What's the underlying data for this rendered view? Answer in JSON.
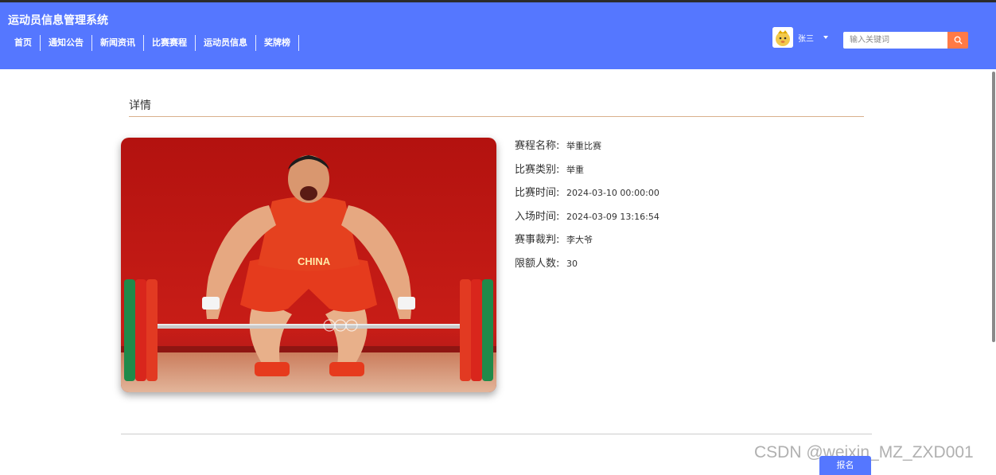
{
  "header": {
    "site_title": "运动员信息管理系统",
    "nav": [
      "首页",
      "通知公告",
      "新闻资讯",
      "比赛赛程",
      "运动员信息",
      "奖牌榜"
    ],
    "user_name": "张三",
    "search_placeholder": "输入关键词"
  },
  "detail": {
    "section_title": "详情",
    "image_text": "CHINA",
    "fields": [
      {
        "label": "赛程名称:",
        "value": "举重比赛"
      },
      {
        "label": "比赛类别:",
        "value": "举重"
      },
      {
        "label": "比赛时间:",
        "value": "2024-03-10 00:00:00"
      },
      {
        "label": "入场时间:",
        "value": "2024-03-09 13:16:54"
      },
      {
        "label": "赛事裁判:",
        "value": "李大爷"
      },
      {
        "label": "限额人数:",
        "value": "30"
      }
    ],
    "signup_label": "报名"
  },
  "watermark": "CSDN @weixin_MZ_ZXD001",
  "colors": {
    "header_bg": "#5577ff",
    "search_button": "#ff7a45",
    "divider": "#d9b08c"
  }
}
